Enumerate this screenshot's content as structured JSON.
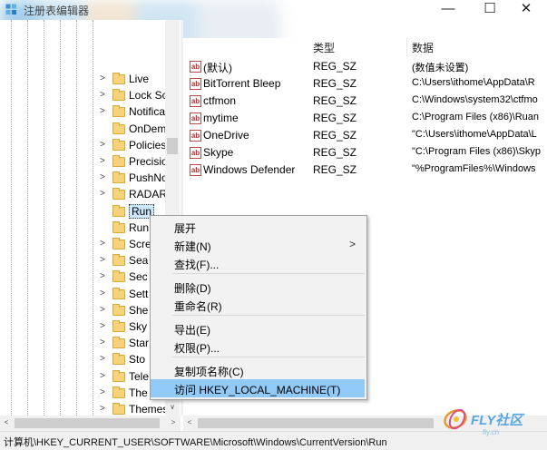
{
  "window": {
    "title": "注册表编辑器",
    "minimize_icon": "—",
    "maximize_icon": "☐",
    "close_icon": "✕"
  },
  "tree": {
    "items": [
      {
        "label": "Live",
        "expander": ">"
      },
      {
        "label": "Lock Sc",
        "expander": ">"
      },
      {
        "label": "Notifica",
        "expander": ">"
      },
      {
        "label": "OnDem",
        "expander": ""
      },
      {
        "label": "Policies",
        "expander": ">"
      },
      {
        "label": "Precisio",
        "expander": ">"
      },
      {
        "label": "PushNo",
        "expander": ">"
      },
      {
        "label": "RADAR",
        "expander": ">"
      },
      {
        "label": "Run",
        "expander": ""
      },
      {
        "label": "Run",
        "expander": ""
      },
      {
        "label": "Scre",
        "expander": ">"
      },
      {
        "label": "Sea",
        "expander": ">"
      },
      {
        "label": "Sec",
        "expander": ">"
      },
      {
        "label": "Sett",
        "expander": ">"
      },
      {
        "label": "She",
        "expander": ">"
      },
      {
        "label": "Sky",
        "expander": ">"
      },
      {
        "label": "Star",
        "expander": ">"
      },
      {
        "label": "Sto",
        "expander": ">"
      },
      {
        "label": "Tele",
        "expander": ">"
      },
      {
        "label": "The",
        "expander": ">"
      },
      {
        "label": "Themes",
        "expander": ">"
      }
    ],
    "selected_label": "Run",
    "scroll_down_icon": "∨"
  },
  "list": {
    "columns": [
      "类型",
      "数据"
    ],
    "rows": [
      {
        "name": "(默认)",
        "type": "REG_SZ",
        "data": "(数值未设置)"
      },
      {
        "name": "BitTorrent Bleep",
        "type": "REG_SZ",
        "data": "C:\\Users\\ithome\\AppData\\R"
      },
      {
        "name": "ctfmon",
        "type": "REG_SZ",
        "data": "C:\\Windows\\system32\\ctfmo"
      },
      {
        "name": "mytime",
        "type": "REG_SZ",
        "data": "C:\\Program Files (x86)\\Ruan"
      },
      {
        "name": "OneDrive",
        "type": "REG_SZ",
        "data": "\"C:\\Users\\ithome\\AppData\\L"
      },
      {
        "name": "Skype",
        "type": "REG_SZ",
        "data": "\"C:\\Program Files (x86)\\Skyp"
      },
      {
        "name": "Windows Defender",
        "type": "REG_SZ",
        "data": "\"%ProgramFiles%\\Windows"
      }
    ],
    "value_icon_text": "ab"
  },
  "context_menu": {
    "items": [
      {
        "label": "展开",
        "submenu": ""
      },
      {
        "label": "新建(N)",
        "submenu": ">"
      },
      {
        "label": "查找(F)...",
        "submenu": ""
      },
      {
        "label": "删除(D)",
        "submenu": ""
      },
      {
        "label": "重命名(R)",
        "submenu": ""
      },
      {
        "label": "导出(E)",
        "submenu": ""
      },
      {
        "label": "权限(P)...",
        "submenu": ""
      },
      {
        "label": "复制项名称(C)",
        "submenu": ""
      },
      {
        "label": "访问 HKEY_LOCAL_MACHINE(T)",
        "submenu": ""
      }
    ],
    "highlighted": "访问 HKEY_LOCAL_MACHINE(T)"
  },
  "scrollbars": {
    "left_arrow": "<",
    "right_arrow": ">"
  },
  "status_bar": {
    "path": "计算机\\HKEY_CURRENT_USER\\SOFTWARE\\Microsoft\\Windows\\CurrentVersion\\Run"
  },
  "watermark": {
    "text": "FLY社区",
    "sub": "fly.cn"
  },
  "colors": {
    "menu_highlight": "#91c9f7",
    "selection": "#cce8ff",
    "folder": "#f6d37b"
  }
}
